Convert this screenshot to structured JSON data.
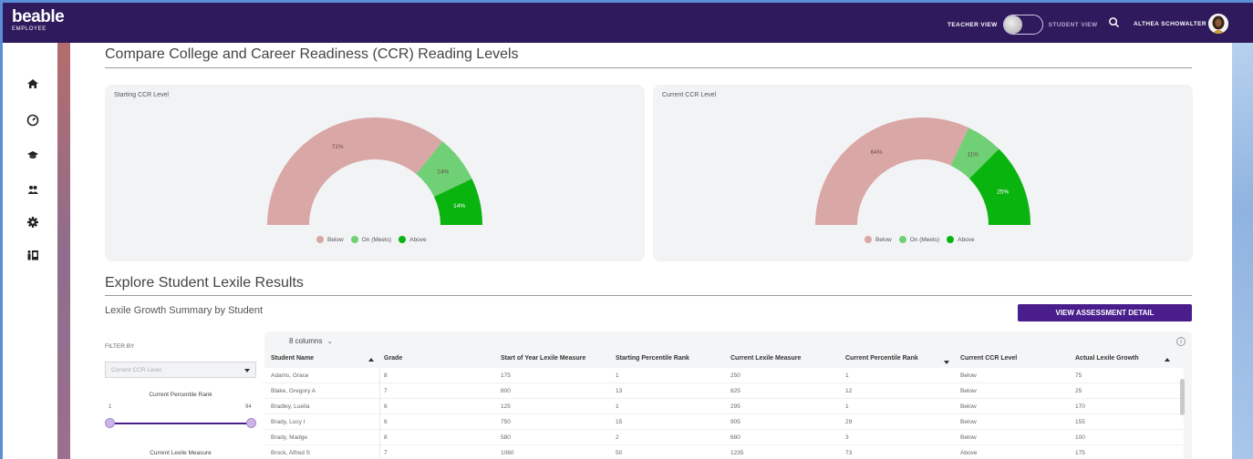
{
  "app": {
    "logo": "beable",
    "logo_sub": "EMPLOYEE"
  },
  "header": {
    "teacher_view": "TEACHER VIEW",
    "student_view": "STUDENT VIEW",
    "user_name": "ALTHEA SCHOWALTER"
  },
  "sidebar": {
    "items": [
      {
        "icon": "home-icon"
      },
      {
        "icon": "dashboard-gauge-icon"
      },
      {
        "icon": "graduation-cap-icon"
      },
      {
        "icon": "users-icon"
      },
      {
        "icon": "gear-icon"
      },
      {
        "icon": "classroom-icon"
      }
    ]
  },
  "section1": {
    "title": "Compare College and Career Readiness (CCR) Reading Levels"
  },
  "colors": {
    "below": "#d9a7a6",
    "on": "#6fd075",
    "above": "#0ab40f",
    "brand": "#4a1d8c",
    "topbar": "#2e1a5c"
  },
  "chart_data": [
    {
      "type": "pie",
      "title": "Starting CCR Level",
      "labels": [
        "Below",
        "On (Meets)",
        "Above"
      ],
      "values": [
        71,
        14,
        14
      ],
      "value_labels": [
        "71%",
        "14%",
        "14%"
      ],
      "style": "semicircle-gauge",
      "legend_position": "bottom"
    },
    {
      "type": "pie",
      "title": "Current CCR Level",
      "labels": [
        "Below",
        "On (Meets)",
        "Above"
      ],
      "values": [
        64,
        11,
        25
      ],
      "value_labels": [
        "64%",
        "11%",
        "25%"
      ],
      "style": "semicircle-gauge",
      "legend_position": "bottom"
    }
  ],
  "section2": {
    "title": "Explore Student Lexile Results",
    "subtitle": "Lexile Growth Summary by Student",
    "button": "VIEW ASSESSMENT DETAIL"
  },
  "filters": {
    "label": "FILTER BY",
    "ccr_placeholder": "Current CCR Level",
    "percentile_title": "Current Percentile Rank",
    "percentile_min": "1",
    "percentile_max": "94",
    "lexile_title": "Current Lexile Measure"
  },
  "table": {
    "columns_toggle": "8 columns",
    "info": "i",
    "headers": [
      "Student Name",
      "Grade",
      "Start of Year Lexile Measure",
      "Starting Percentile Rank",
      "Current Lexile Measure",
      "Current Percentile Rank",
      "Current CCR Level",
      "Actual Lexile Growth"
    ],
    "rows": [
      [
        "Adams, Grace",
        "8",
        "175",
        "1",
        "250",
        "1",
        "Below",
        "75"
      ],
      [
        "Blake, Gregory A",
        "7",
        "800",
        "13",
        "825",
        "12",
        "Below",
        "25"
      ],
      [
        "Bradley, Luella",
        "6",
        "125",
        "1",
        "295",
        "1",
        "Below",
        "170"
      ],
      [
        "Brady, Lucy I",
        "6",
        "750",
        "15",
        "905",
        "29",
        "Below",
        "155"
      ],
      [
        "Brady, Madge",
        "8",
        "580",
        "2",
        "680",
        "3",
        "Below",
        "100"
      ],
      [
        "Brock, Alfred S",
        "7",
        "1060",
        "50",
        "1235",
        "73",
        "Above",
        "175"
      ]
    ]
  }
}
